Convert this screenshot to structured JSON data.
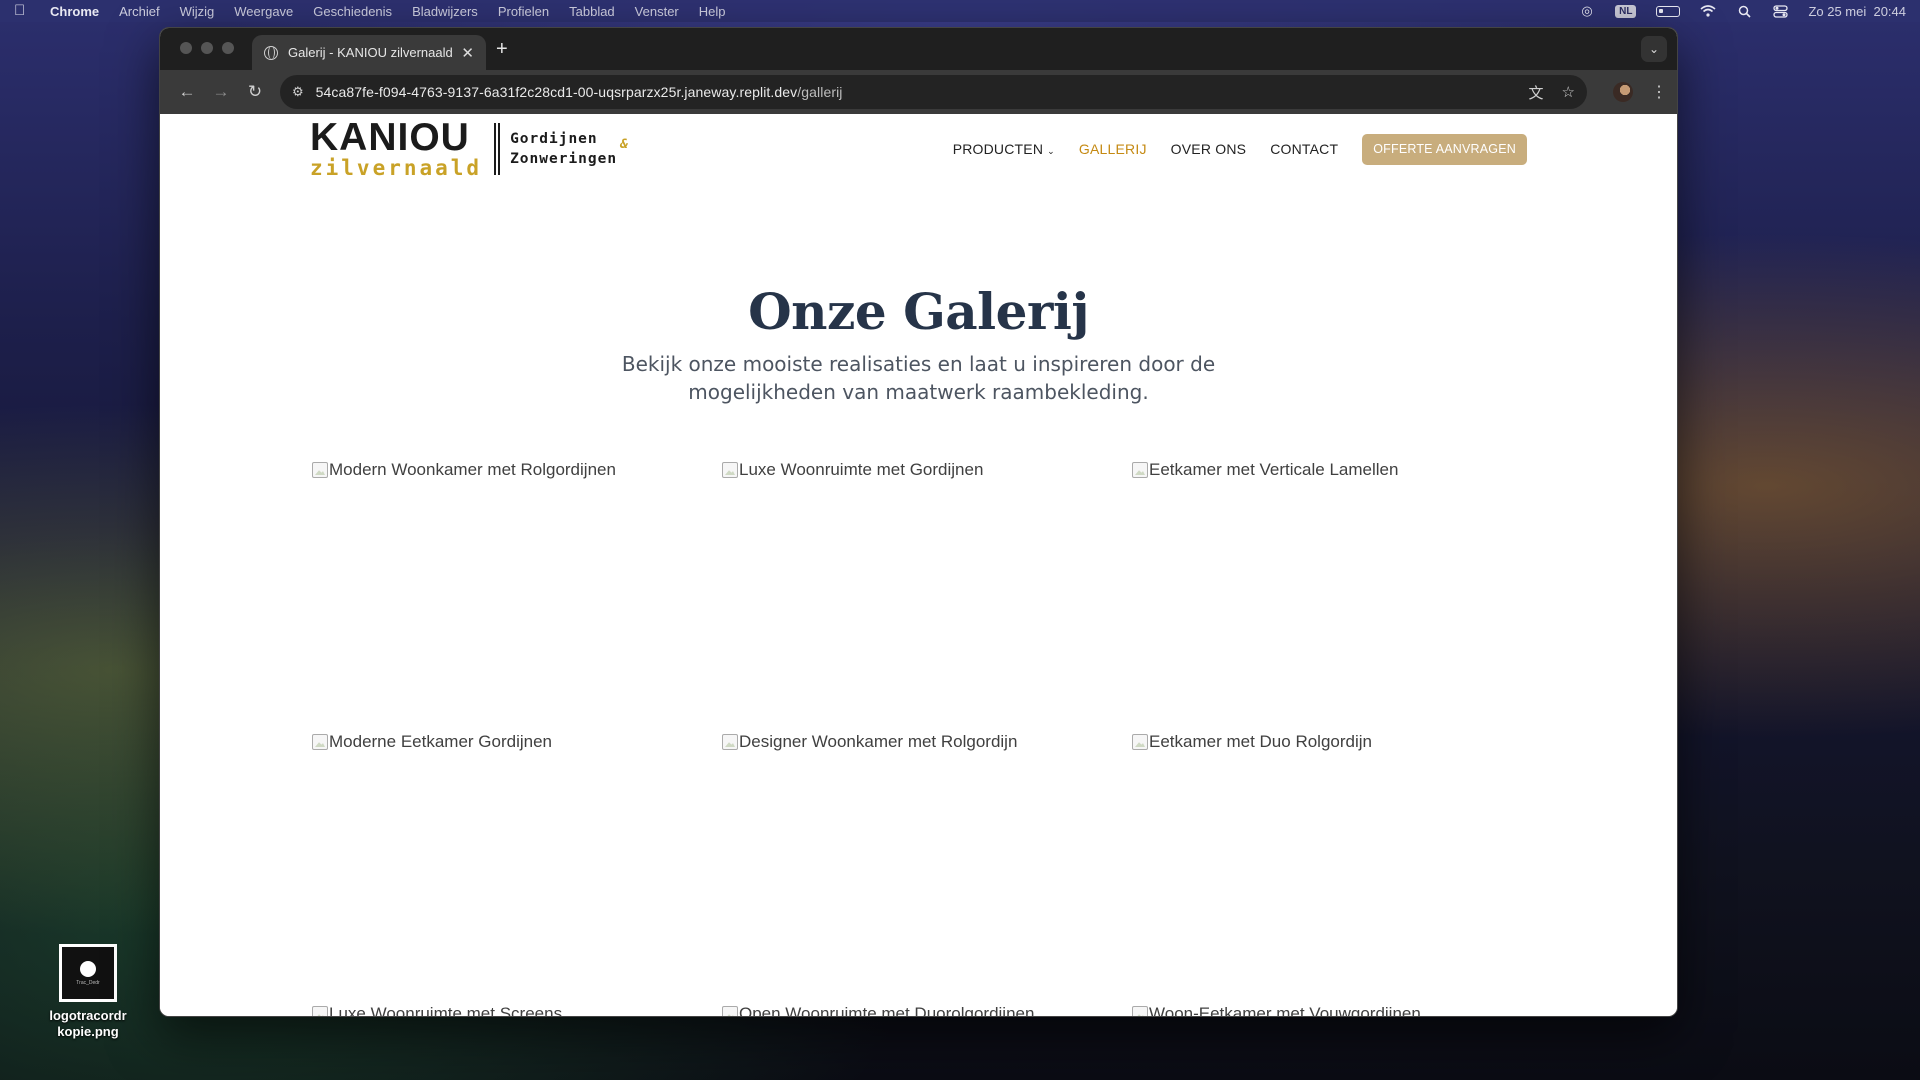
{
  "menubar": {
    "app_name": "Chrome",
    "items": [
      "Archief",
      "Wijzig",
      "Weergave",
      "Geschiedenis",
      "Bladwijzers",
      "Profielen",
      "Tabblad",
      "Venster",
      "Help"
    ],
    "language_badge": "NL",
    "datetime": "Zo 25 mei  20:44"
  },
  "desktop": {
    "file_name": "logotracordr kopie.png",
    "file_thumb_text": "Trac_Dedr"
  },
  "browser": {
    "tab_title": "Galerij - KANIOU zilvernaald",
    "url_host": "54ca87fe-f094-4763-9137-6a31f2c28cd1-00-uqsrparzx25r.janeway.replit.dev",
    "url_path": "/gallerij"
  },
  "site": {
    "logo": {
      "name": "KANIOU",
      "sub": "zilvernaald",
      "tag_line1": "Gordijnen",
      "tag_amp": "&",
      "tag_line2": "Zonweringen"
    },
    "nav": {
      "producten": "PRODUCTEN",
      "gallerij": "GALLERIJ",
      "over_ons": "OVER ONS",
      "contact": "CONTACT",
      "cta": "OFFERTE AANVRAGEN"
    },
    "hero": {
      "title": "Onze Galerij",
      "subtitle": "Bekijk onze mooiste realisaties en laat u inspireren door de mogelijkheden van maatwerk raambekleding."
    },
    "gallery": [
      "Modern Woonkamer met Rolgordijnen",
      "Luxe Woonruimte met Gordijnen",
      "Eetkamer met Verticale Lamellen",
      "Moderne Eetkamer Gordijnen",
      "Designer Woonkamer met Rolgordijn",
      "Eetkamer met Duo Rolgordijn",
      "Luxe Woonruimte met Screens",
      "Open Woonruimte met Duorolgordijnen",
      "Woon-Eetkamer met Vouwgordijnen"
    ]
  }
}
